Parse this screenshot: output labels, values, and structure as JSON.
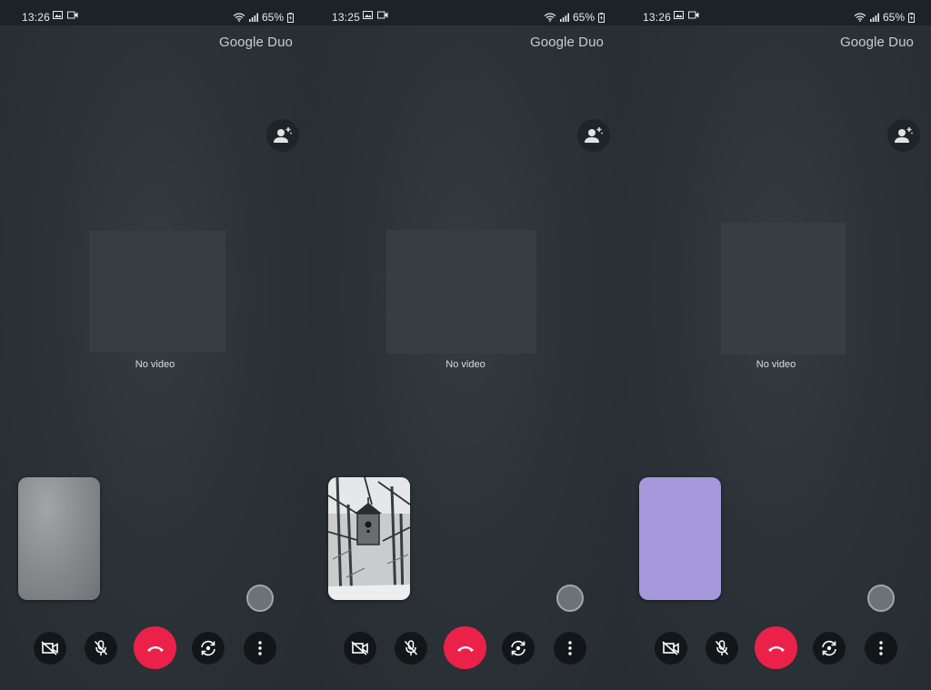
{
  "brand": "Google Duo",
  "no_video_label": "No video",
  "colors": {
    "end_call": "#ec214a",
    "background": "#2c3338",
    "self_view_purple": "#a599dc"
  },
  "screens": [
    {
      "status": {
        "time": "13:26",
        "battery": "65%"
      },
      "self_view": "blurred-camera"
    },
    {
      "status": {
        "time": "13:25",
        "battery": "65%"
      },
      "self_view": "birdhouse-photo"
    },
    {
      "status": {
        "time": "13:26",
        "battery": "65%"
      },
      "self_view": "purple-placeholder"
    }
  ],
  "icons": {
    "status_left": [
      "gallery-icon",
      "video-record-icon"
    ],
    "status_right": [
      "wifi-icon",
      "signal-icon",
      "battery-charging-icon"
    ],
    "controls": [
      "video-off-icon",
      "mic-off-icon",
      "end-call-icon",
      "switch-camera-icon",
      "more-icon"
    ],
    "add_person": "add-person-icon"
  }
}
